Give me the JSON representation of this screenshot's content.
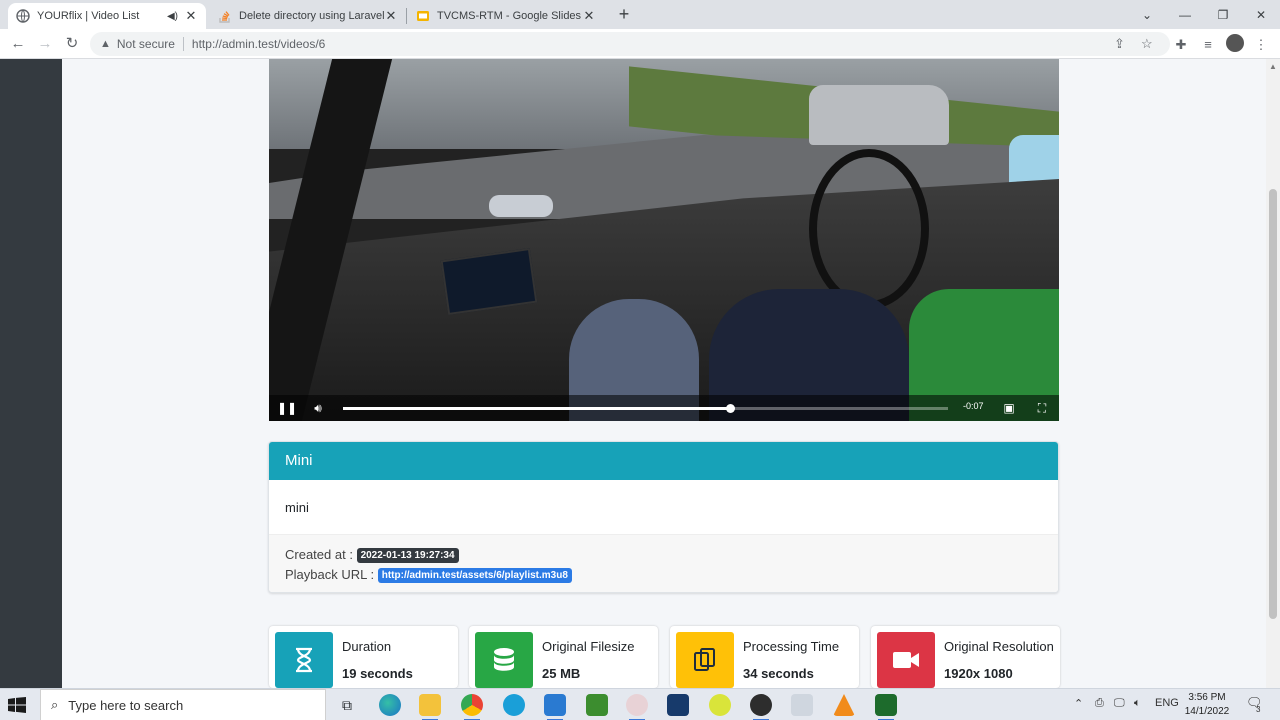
{
  "browser": {
    "tabs": [
      {
        "title": "YOURflix | Video List",
        "active": true,
        "audio": true
      },
      {
        "title": "Delete directory using Laravel Sto",
        "active": false
      },
      {
        "title": "TVCMS-RTM - Google Slides",
        "active": false
      }
    ],
    "security_label": "Not secure",
    "url": "http://admin.test/videos/6"
  },
  "player": {
    "time_remaining": "-0:07",
    "progress": 0.64
  },
  "video_card": {
    "title": "Mini",
    "description": "mini",
    "created_label": "Created at :",
    "created_value": "2022-01-13 19:27:34",
    "playback_label": "Playback URL :",
    "playback_value": "http://admin.test/assets/6/playlist.m3u8"
  },
  "stats": [
    {
      "title": "Duration",
      "value": "19 seconds",
      "icon": "hourglass-icon",
      "color": "#17a2b8"
    },
    {
      "title": "Original Filesize",
      "value": "25 MB",
      "icon": "database-icon",
      "color": "#28a745"
    },
    {
      "title": "Processing Time",
      "value": "34 seconds",
      "icon": "copy-icon",
      "color": "#ffc107"
    },
    {
      "title": "Original Resolution",
      "value": "1920x 1080",
      "icon": "video-camera-icon",
      "color": "#dc3545"
    }
  ],
  "taskbar": {
    "search_placeholder": "Type here to search",
    "language": "ENG",
    "time": "3:56 PM",
    "date": "14/1/2022",
    "notification_count": "3"
  }
}
